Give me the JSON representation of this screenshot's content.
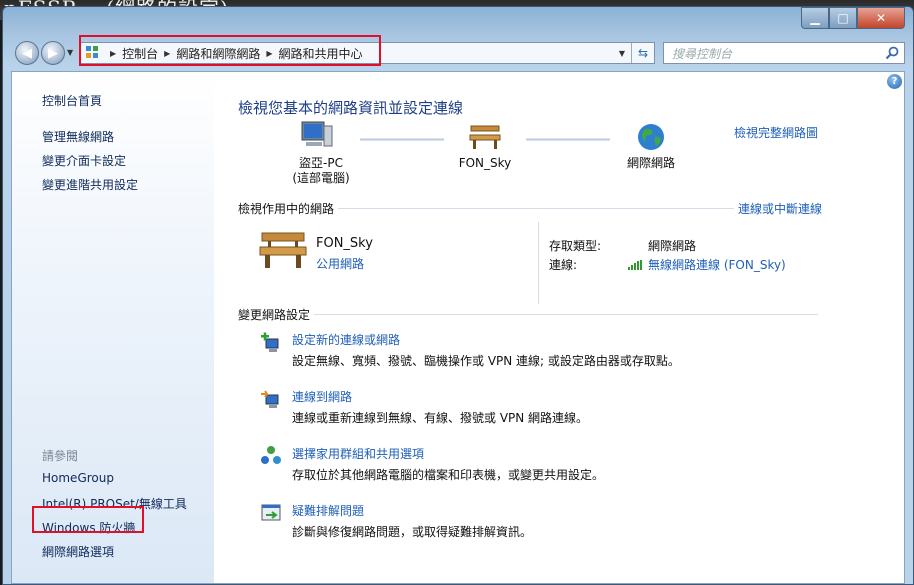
{
  "window": {
    "background_title": "nFSSR… (網路的設定)",
    "controls": {
      "minimize": "▁",
      "maximize": "□",
      "close": "✕"
    }
  },
  "nav": {
    "breadcrumbs": [
      "控制台",
      "網路和網際網路",
      "網路和共用中心"
    ],
    "search_placeholder": "搜尋控制台"
  },
  "sidebar": {
    "home": "控制台首頁",
    "links": [
      "管理無線網路",
      "變更介面卡設定",
      "變更進階共用設定"
    ],
    "see_also_title": "請參閱",
    "see_also": [
      "HomeGroup",
      "Intel(R) PROSet/無線工具",
      "Windows 防火牆",
      "網際網路選項"
    ]
  },
  "main": {
    "title": "檢視您基本的網路資訊並設定連線",
    "full_map_link": "檢視完整網路圖",
    "map_nodes": [
      {
        "label": "盜亞-PC",
        "sub": "(這部電腦)"
      },
      {
        "label": "FON_Sky",
        "sub": ""
      },
      {
        "label": "網際網路",
        "sub": ""
      }
    ],
    "active_section": "檢視作用中的網路",
    "connect_link": "連線或中斷連線",
    "network": {
      "name": "FON_Sky",
      "type": "公用網路",
      "access_label": "存取類型:",
      "access_value": "網際網路",
      "conn_label": "連線:",
      "conn_value": "無線網路連線 (FON_Sky)"
    },
    "change_section": "變更網路設定",
    "tasks": [
      {
        "link": "設定新的連線或網路",
        "desc": "設定無線、寬頻、撥號、臨機操作或 VPN 連線; 或設定路由器或存取點。"
      },
      {
        "link": "連線到網路",
        "desc": "連線或重新連線到無線、有線、撥號或 VPN 網路連線。"
      },
      {
        "link": "選擇家用群組和共用選項",
        "desc": "存取位於其他網路電腦的檔案和印表機，或變更共用設定。"
      },
      {
        "link": "疑難排解問題",
        "desc": "診斷與修復網路問題，或取得疑難排解資訊。"
      }
    ]
  },
  "colors": {
    "link": "#1e5fb8",
    "title": "#1e3f87",
    "highlight": "#e0102a"
  }
}
